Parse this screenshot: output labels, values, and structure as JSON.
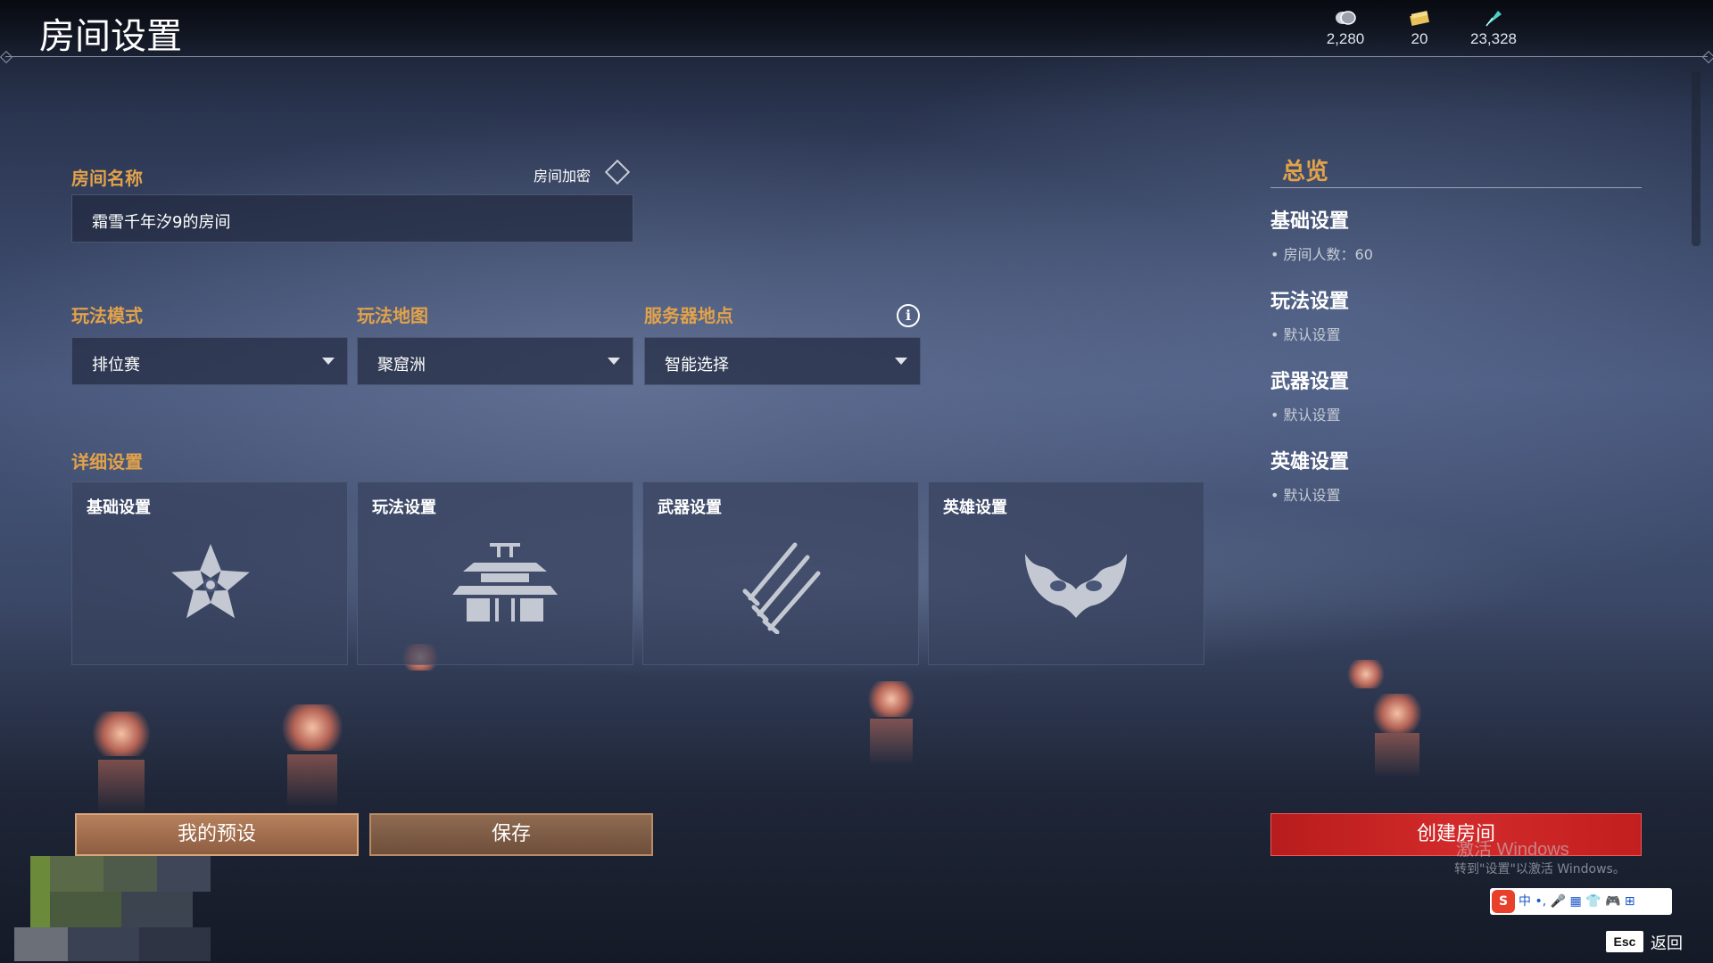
{
  "header": {
    "title": "房间设置"
  },
  "currencies": [
    {
      "icon": "coin-icon",
      "value": "2,280"
    },
    {
      "icon": "ticket-icon",
      "value": "20"
    },
    {
      "icon": "feather-icon",
      "value": "23,328"
    }
  ],
  "room": {
    "name_label": "房间名称",
    "name_value": "霜雪千年汐9的房间",
    "encrypt_label": "房间加密"
  },
  "mode": {
    "label": "玩法模式",
    "value": "排位赛"
  },
  "map": {
    "label": "玩法地图",
    "value": "聚窟洲"
  },
  "server": {
    "label": "服务器地点",
    "value": "智能选择"
  },
  "details": {
    "label": "详细设置",
    "cards": [
      {
        "title": "基础设置",
        "icon": "flower-icon"
      },
      {
        "title": "玩法设置",
        "icon": "temple-icon"
      },
      {
        "title": "武器设置",
        "icon": "swords-icon"
      },
      {
        "title": "英雄设置",
        "icon": "mask-icon"
      }
    ]
  },
  "overview": {
    "title": "总览",
    "sections": [
      {
        "heading": "基础设置",
        "detail": "• 房间人数：60"
      },
      {
        "heading": "玩法设置",
        "detail": "• 默认设置"
      },
      {
        "heading": "武器设置",
        "detail": "• 默认设置"
      },
      {
        "heading": "英雄设置",
        "detail": "• 默认设置"
      }
    ]
  },
  "buttons": {
    "presets": "我的预设",
    "save": "保存",
    "create": "创建房间"
  },
  "watermark": {
    "line1": "激活 Windows",
    "line2": "转到\"设置\"以激活 Windows。"
  },
  "ime": {
    "text": "中 •, 🎤 ▦ 👕 🎮 ⊞",
    "logo": "S"
  },
  "esc": {
    "key": "Esc",
    "label": "返回"
  },
  "colors": {
    "accent_gold": "#e2a24a",
    "create_red": "#d22a2a"
  }
}
